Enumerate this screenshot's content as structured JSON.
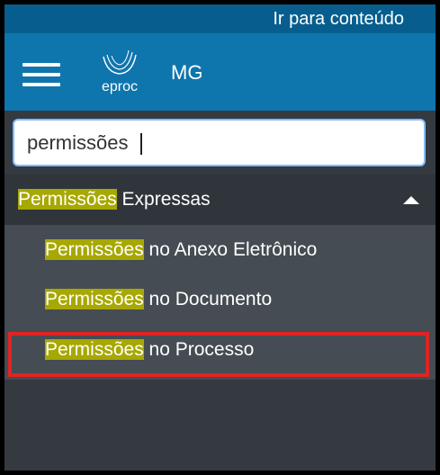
{
  "skip_link": "Ir para conteúdo",
  "header": {
    "logo_text": "eproc",
    "org": "MG"
  },
  "search": {
    "value": "permissões"
  },
  "menu": {
    "group": {
      "match": "Permissões",
      "rest": " Expressas"
    },
    "items": [
      {
        "match": "Permissões",
        "rest": " no Anexo Eletrônico"
      },
      {
        "match": "Permissões",
        "rest": " no Documento"
      },
      {
        "match": "Permissões",
        "rest": " no Processo"
      }
    ]
  },
  "colors": {
    "skipbar": "#075e8e",
    "header": "#0f75ad",
    "menu_bg": "#343a40",
    "submenu_bg": "#454c53",
    "match_highlight": "#a7a800",
    "annotation_box": "#e02424"
  },
  "icons": [
    "hamburger-menu-icon",
    "eproc-logo-icon",
    "chevron-up-icon"
  ]
}
